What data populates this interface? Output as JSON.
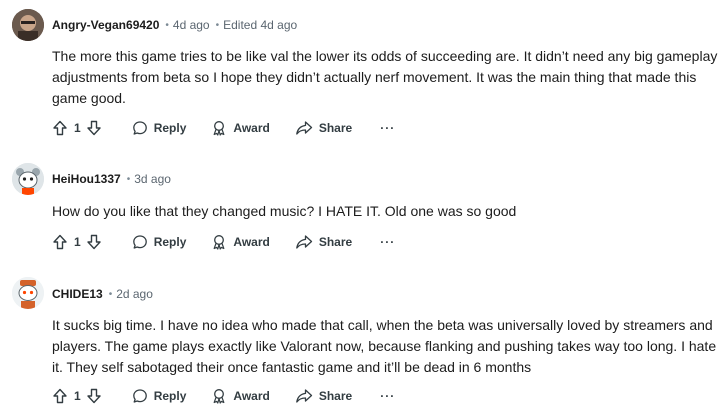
{
  "comments": [
    {
      "author": "Angry-Vegan69420",
      "time": "4d ago",
      "edited": "Edited 4d ago",
      "body": "The more this game tries to be like val the lower its odds of succeeding are. It didn’t need any big gameplay adjustments from beta so I hope they didn’t actually nerf movement. It was the main thing that made this game good.",
      "votes": "1",
      "avatar_color": "#4a3b33"
    },
    {
      "author": "HeiHou1337",
      "time": "3d ago",
      "body": "How do you like that they changed music? I HATE IT. Old one was so good",
      "votes": "1",
      "avatar_color": "#cfd8dc"
    },
    {
      "author": "CHIDE13",
      "time": "2d ago",
      "body": "It sucks big time. I have no idea who made that call, when the beta was universally loved by streamers and players. The game plays exactly like Valorant now, because flanking and pushing takes way too long. I hate it. They self sabotaged their once fantastic game and it’ll be dead in 6 months",
      "votes": "1",
      "avatar_color": "#e8eef2"
    }
  ],
  "actions": {
    "reply": "Reply",
    "award": "Award",
    "share": "Share",
    "more": "···"
  },
  "separator": "•"
}
